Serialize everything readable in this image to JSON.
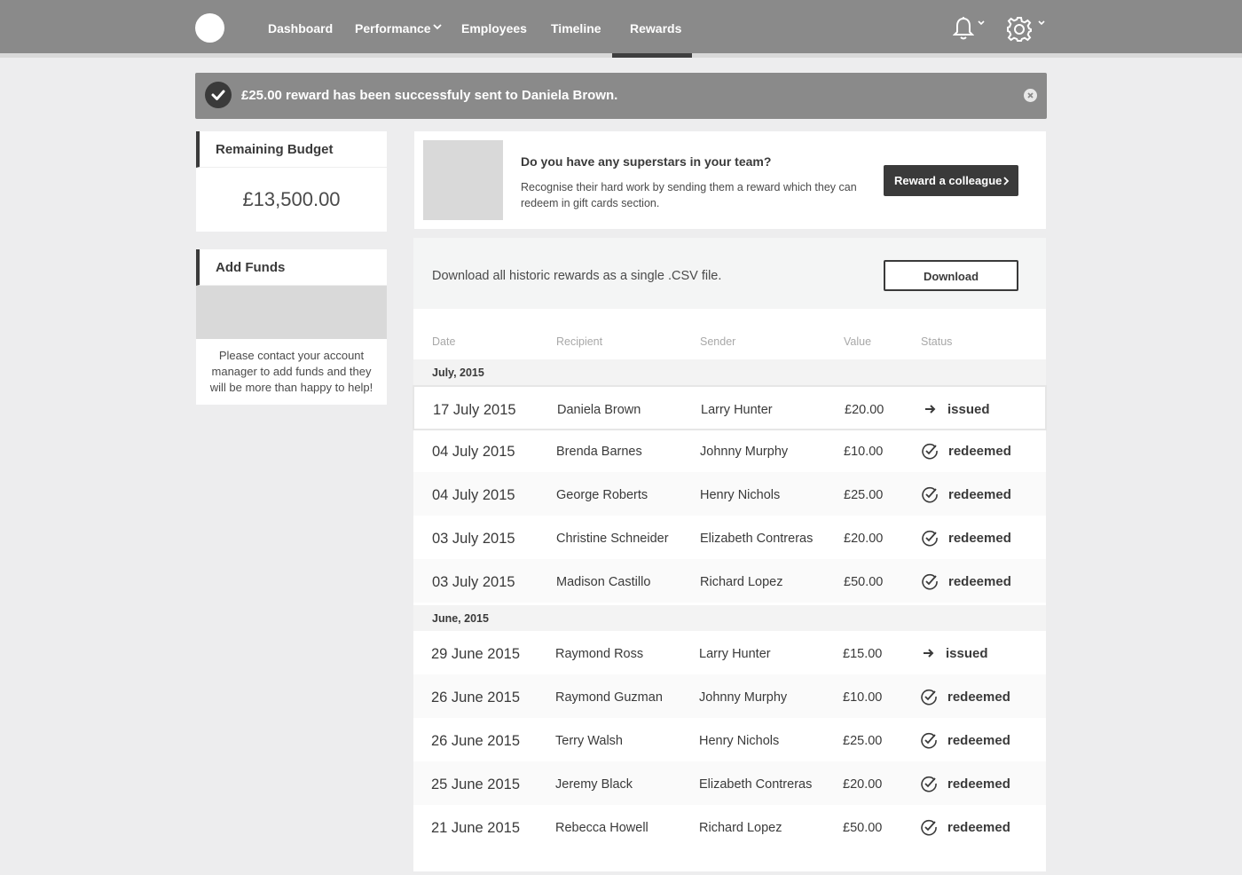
{
  "nav": {
    "items": [
      {
        "label": "Dashboard"
      },
      {
        "label": "Performance"
      },
      {
        "label": "Employees"
      },
      {
        "label": "Timeline"
      },
      {
        "label": "Rewards"
      }
    ],
    "active": "Rewards",
    "icons": [
      "logo",
      "bell-icon",
      "gear-icon",
      "chevron-down-icon"
    ]
  },
  "alert": {
    "message": "£25.00 reward has been successfuly sent to Daniela Brown."
  },
  "budget": {
    "title": "Remaining Budget",
    "value": "£13,500.00"
  },
  "funds": {
    "title": "Add Funds",
    "text": "Please contact your account manager to add funds and they will be more than happy to help!"
  },
  "promo": {
    "title": "Do you have any superstars in your team?",
    "description": "Recognise their hard work by sending them a reward which they can redeem in gift cards section.",
    "button": "Reward a colleague"
  },
  "download": {
    "text": "Download all historic rewards as a single .CSV file.",
    "button": "Download"
  },
  "table": {
    "headers": [
      "Date",
      "Recipient",
      "Sender",
      "Value",
      "Status"
    ],
    "groups": [
      {
        "label": "July, 2015",
        "rows": [
          {
            "date": "17 July 2015",
            "recipient": "Daniela Brown",
            "sender": "Larry Hunter",
            "value": "£20.00",
            "status": "issued"
          },
          {
            "date": "04 July 2015",
            "recipient": "Brenda Barnes",
            "sender": "Johnny Murphy",
            "value": "£10.00",
            "status": "redeemed"
          },
          {
            "date": "04 July 2015",
            "recipient": "George Roberts",
            "sender": "Henry Nichols",
            "value": "£25.00",
            "status": "redeemed"
          },
          {
            "date": "03 July 2015",
            "recipient": "Christine Schneider",
            "sender": "Elizabeth Contreras",
            "value": "£20.00",
            "status": "redeemed"
          },
          {
            "date": "03 July 2015",
            "recipient": "Madison Castillo",
            "sender": "Richard Lopez",
            "value": "£50.00",
            "status": "redeemed"
          }
        ]
      },
      {
        "label": "June, 2015",
        "rows": [
          {
            "date": "29 June 2015",
            "recipient": "Raymond Ross",
            "sender": "Larry Hunter",
            "value": "£15.00",
            "status": "issued"
          },
          {
            "date": "26 June 2015",
            "recipient": "Raymond Guzman",
            "sender": "Johnny Murphy",
            "value": "£10.00",
            "status": "redeemed"
          },
          {
            "date": "26 June 2015",
            "recipient": "Terry Walsh",
            "sender": "Henry Nichols",
            "value": "£25.00",
            "status": "redeemed"
          },
          {
            "date": "25 June 2015",
            "recipient": "Jeremy Black",
            "sender": "Elizabeth Contreras",
            "value": "£20.00",
            "status": "redeemed"
          },
          {
            "date": "21 June 2015",
            "recipient": "Rebecca Howell",
            "sender": "Richard Lopez",
            "value": "£50.00",
            "status": "redeemed"
          }
        ]
      }
    ]
  }
}
